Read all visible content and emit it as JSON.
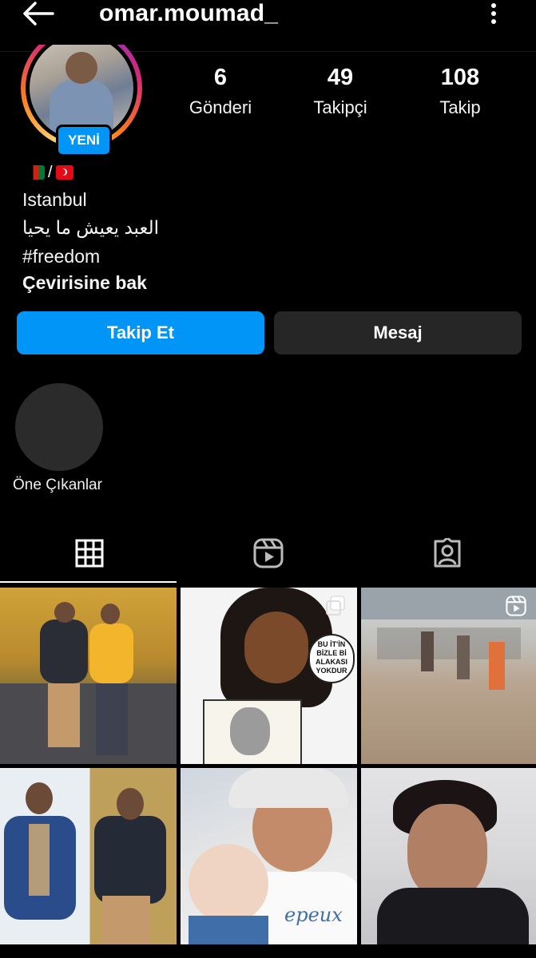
{
  "header": {
    "username": "omar.moumad_"
  },
  "profile": {
    "new_badge": "YENİ",
    "stats": [
      {
        "value": "6",
        "label": "Gönderi"
      },
      {
        "value": "49",
        "label": "Takipçi"
      },
      {
        "value": "108",
        "label": "Takip"
      }
    ]
  },
  "bio": {
    "flags": [
      "afghanistan-flag",
      "turkey-flag"
    ],
    "flag_separator": "/",
    "location": "Istanbul",
    "arabic_line": "العبد يعيش ما يحيا",
    "hashtag": "#freedom",
    "translate_link": "Çevirisine bak"
  },
  "actions": {
    "follow_label": "Takip Et",
    "message_label": "Mesaj"
  },
  "highlights": {
    "label": "Öne Çıkanlar"
  },
  "tabs": [
    {
      "icon": "grid-icon",
      "active": true
    },
    {
      "icon": "reels-icon",
      "active": false
    },
    {
      "icon": "tagged-icon",
      "active": false
    }
  ],
  "meme": {
    "speech_bubble": "BU İT'İN\nBİZLE Bİ\nALAKASI\nYOKDUR"
  },
  "photo_shirt_text": "epeux",
  "colors": {
    "accent": "#0095f6",
    "secondary_button": "#262626",
    "background": "#000000"
  }
}
